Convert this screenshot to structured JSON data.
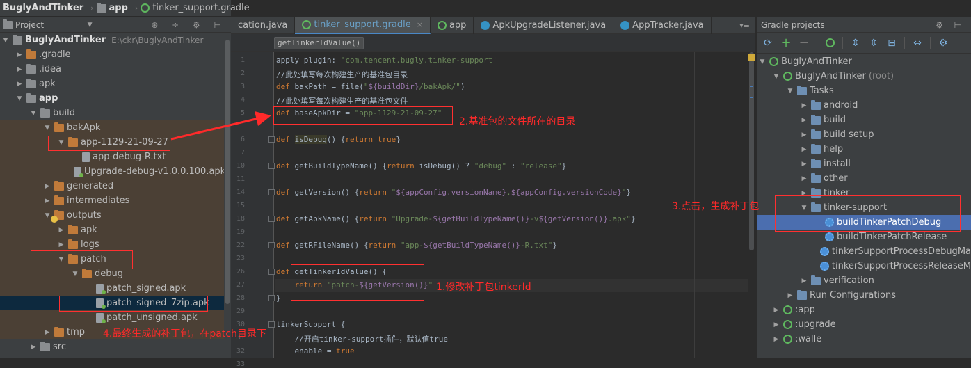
{
  "navbar": {
    "project": "BuglyAndTinker",
    "module": "app",
    "file": "tinker_support.gradle"
  },
  "project_panel": {
    "title": "Project",
    "tools": "⊕ ÷ ⚙ ⊢",
    "tree": [
      {
        "label": "BuglyAndTinker",
        "path": "E:\\ckr\\BuglyAndTinker",
        "depth": 0,
        "arrow": "▼",
        "icon": "folder-grey",
        "bold": true
      },
      {
        "label": ".gradle",
        "depth": 1,
        "arrow": "▶",
        "icon": "folder"
      },
      {
        "label": ".idea",
        "depth": 1,
        "arrow": "▶",
        "icon": "folder-grey"
      },
      {
        "label": "apk",
        "depth": 1,
        "arrow": "▶",
        "icon": "folder-grey"
      },
      {
        "label": "app",
        "depth": 1,
        "arrow": "▼",
        "icon": "folder-grey",
        "bold": true
      },
      {
        "label": "build",
        "depth": 2,
        "arrow": "▼",
        "icon": "folder-grey"
      },
      {
        "label": "bakApk",
        "depth": 3,
        "arrow": "▼",
        "icon": "folder",
        "hl": true
      },
      {
        "label": "app-1129-21-09-27",
        "depth": 4,
        "arrow": "▼",
        "icon": "folder",
        "hl": true
      },
      {
        "label": "app-debug-R.txt",
        "depth": 5,
        "arrow": "",
        "icon": "file",
        "hl": true
      },
      {
        "label": "Upgrade-debug-v1.0.0.100.apk",
        "depth": 5,
        "arrow": "",
        "icon": "apk",
        "hl": true
      },
      {
        "label": "generated",
        "depth": 3,
        "arrow": "▶",
        "icon": "folder",
        "hl": true
      },
      {
        "label": "intermediates",
        "depth": 3,
        "arrow": "▶",
        "icon": "folder",
        "hl": true
      },
      {
        "label": "outputs",
        "depth": 3,
        "arrow": "▼",
        "icon": "folder",
        "hl": true
      },
      {
        "label": "apk",
        "depth": 4,
        "arrow": "▶",
        "icon": "folder",
        "hl": true
      },
      {
        "label": "logs",
        "depth": 4,
        "arrow": "▶",
        "icon": "folder",
        "hl": true
      },
      {
        "label": "patch",
        "depth": 4,
        "arrow": "▼",
        "icon": "folder",
        "hl": true
      },
      {
        "label": "debug",
        "depth": 5,
        "arrow": "▼",
        "icon": "folder",
        "hl": true
      },
      {
        "label": "patch_signed.apk",
        "depth": 6,
        "arrow": "",
        "icon": "apk",
        "hl": true
      },
      {
        "label": "patch_signed_7zip.apk",
        "depth": 6,
        "arrow": "",
        "icon": "apk",
        "sel": true
      },
      {
        "label": "patch_unsigned.apk",
        "depth": 6,
        "arrow": "",
        "icon": "apk",
        "hl": true
      },
      {
        "label": "tmp",
        "depth": 3,
        "arrow": "▶",
        "icon": "folder",
        "hl": true
      },
      {
        "label": "src",
        "depth": 2,
        "arrow": "▶",
        "icon": "folder-grey"
      }
    ]
  },
  "editor": {
    "tabs": [
      {
        "label": "cation.java",
        "icon": ""
      },
      {
        "label": "tinker_support.gradle",
        "icon": "gradle",
        "active": true
      },
      {
        "label": "app",
        "icon": "gradle"
      },
      {
        "label": "ApkUpgradeListener.java",
        "icon": "class"
      },
      {
        "label": "AppTracker.java",
        "icon": "class"
      }
    ],
    "tab_menu": "▾≡",
    "crumb": "getTinkerIdValue()",
    "line_numbers": [
      "1",
      "2",
      "3",
      "4",
      "5",
      "6",
      "7",
      "10",
      "11",
      "14",
      "15",
      "18",
      "19",
      "22",
      "23",
      "26",
      "27",
      "28",
      "29",
      "30",
      "31",
      "32",
      "33"
    ]
  },
  "annotations": {
    "a1": "1.修改补丁包tinkerId",
    "a2": "2.基准包的文件所在的目录",
    "a3": "3.点击，生成补丁包",
    "a4": "4.最终生成的补丁包，在patch目录下"
  },
  "gradle_panel": {
    "title": "Gradle projects",
    "tools": "⚙ ⊢",
    "tree": [
      {
        "label": "BuglyAndTinker",
        "depth": 0,
        "arrow": "▼",
        "icon": "module"
      },
      {
        "label": "BuglyAndTinker",
        "suffix": "(root)",
        "depth": 1,
        "arrow": "▼",
        "icon": "module"
      },
      {
        "label": "Tasks",
        "depth": 2,
        "arrow": "▼",
        "icon": "folder-blue"
      },
      {
        "label": "android",
        "depth": 3,
        "arrow": "▶",
        "icon": "folder-blue"
      },
      {
        "label": "build",
        "depth": 3,
        "arrow": "▶",
        "icon": "folder-blue"
      },
      {
        "label": "build setup",
        "depth": 3,
        "arrow": "▶",
        "icon": "folder-blue"
      },
      {
        "label": "help",
        "depth": 3,
        "arrow": "▶",
        "icon": "folder-blue"
      },
      {
        "label": "install",
        "depth": 3,
        "arrow": "▶",
        "icon": "folder-blue"
      },
      {
        "label": "other",
        "depth": 3,
        "arrow": "▶",
        "icon": "folder-blue"
      },
      {
        "label": "tinker",
        "depth": 3,
        "arrow": "▶",
        "icon": "folder-blue"
      },
      {
        "label": "tinker-support",
        "depth": 3,
        "arrow": "▼",
        "icon": "folder-blue"
      },
      {
        "label": "buildTinkerPatchDebug",
        "depth": 4,
        "arrow": "",
        "icon": "gear",
        "sel": true
      },
      {
        "label": "buildTinkerPatchRelease",
        "depth": 4,
        "arrow": "",
        "icon": "gear"
      },
      {
        "label": "tinkerSupportProcessDebugMa",
        "depth": 4,
        "arrow": "",
        "icon": "gear"
      },
      {
        "label": "tinkerSupportProcessReleaseM",
        "depth": 4,
        "arrow": "",
        "icon": "gear"
      },
      {
        "label": "verification",
        "depth": 3,
        "arrow": "▶",
        "icon": "folder-blue"
      },
      {
        "label": "Run Configurations",
        "depth": 2,
        "arrow": "▶",
        "icon": "folder-blue"
      },
      {
        "label": ":app",
        "depth": 1,
        "arrow": "▶",
        "icon": "module"
      },
      {
        "label": ":upgrade",
        "depth": 1,
        "arrow": "▶",
        "icon": "module"
      },
      {
        "label": ":walle",
        "depth": 1,
        "arrow": "▶",
        "icon": "module"
      }
    ]
  },
  "colors": {
    "keyword": "#cc7832",
    "string": "#6a8759",
    "gstring": "#9876aa",
    "annotation": "#ff2a2a",
    "selection": "#4b6eaf"
  }
}
